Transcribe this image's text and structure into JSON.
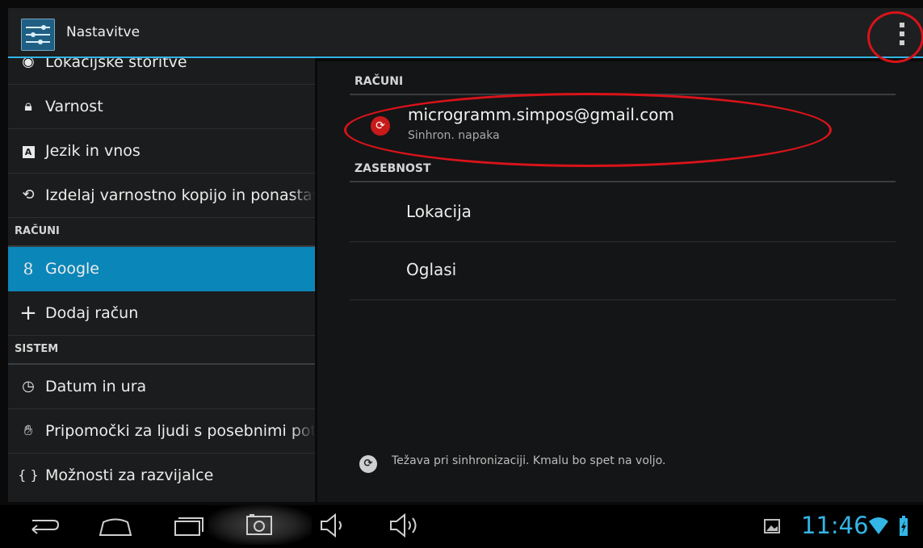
{
  "app": {
    "title": "Nastavitve",
    "icon": "settings-sliders-icon"
  },
  "left_menu": {
    "items": [
      {
        "label": "Lokacijske storitve",
        "icon": "location-icon"
      },
      {
        "label": "Varnost",
        "icon": "lock-icon"
      },
      {
        "label": "Jezik in vnos",
        "icon": "keyboard-icon"
      },
      {
        "label": "Izdelaj varnostno kopijo in ponastavi",
        "icon": "backup-icon"
      }
    ],
    "section_accounts": "RAČUNI",
    "accounts": [
      {
        "label": "Google",
        "icon": "google-icon"
      },
      {
        "label": "Dodaj račun",
        "icon": "plus-icon"
      }
    ],
    "section_system": "SISTEM",
    "system": [
      {
        "label": "Datum in ura",
        "icon": "clock-icon"
      },
      {
        "label": "Pripomočki za ljudi s posebnimi potrebami",
        "icon": "hand-icon"
      },
      {
        "label": "Možnosti za razvijalce",
        "icon": "braces-icon"
      }
    ]
  },
  "right": {
    "section_accounts": "RAČUNI",
    "account": {
      "email": "microgramm.simpos@gmail.com",
      "status": "Sinhron. napaka",
      "icon": "sync-error-icon"
    },
    "section_privacy": "ZASEBNOST",
    "privacy_items": [
      "Lokacija",
      "Oglasi"
    ],
    "sync_notice": "Težava pri sinhronizaciji. Kmalu bo spet na voljo."
  },
  "status_bar": {
    "time": "11:46"
  },
  "colors": {
    "accent": "#33b5e5",
    "selected": "#0b86b8",
    "annotation": "#d9131a"
  }
}
